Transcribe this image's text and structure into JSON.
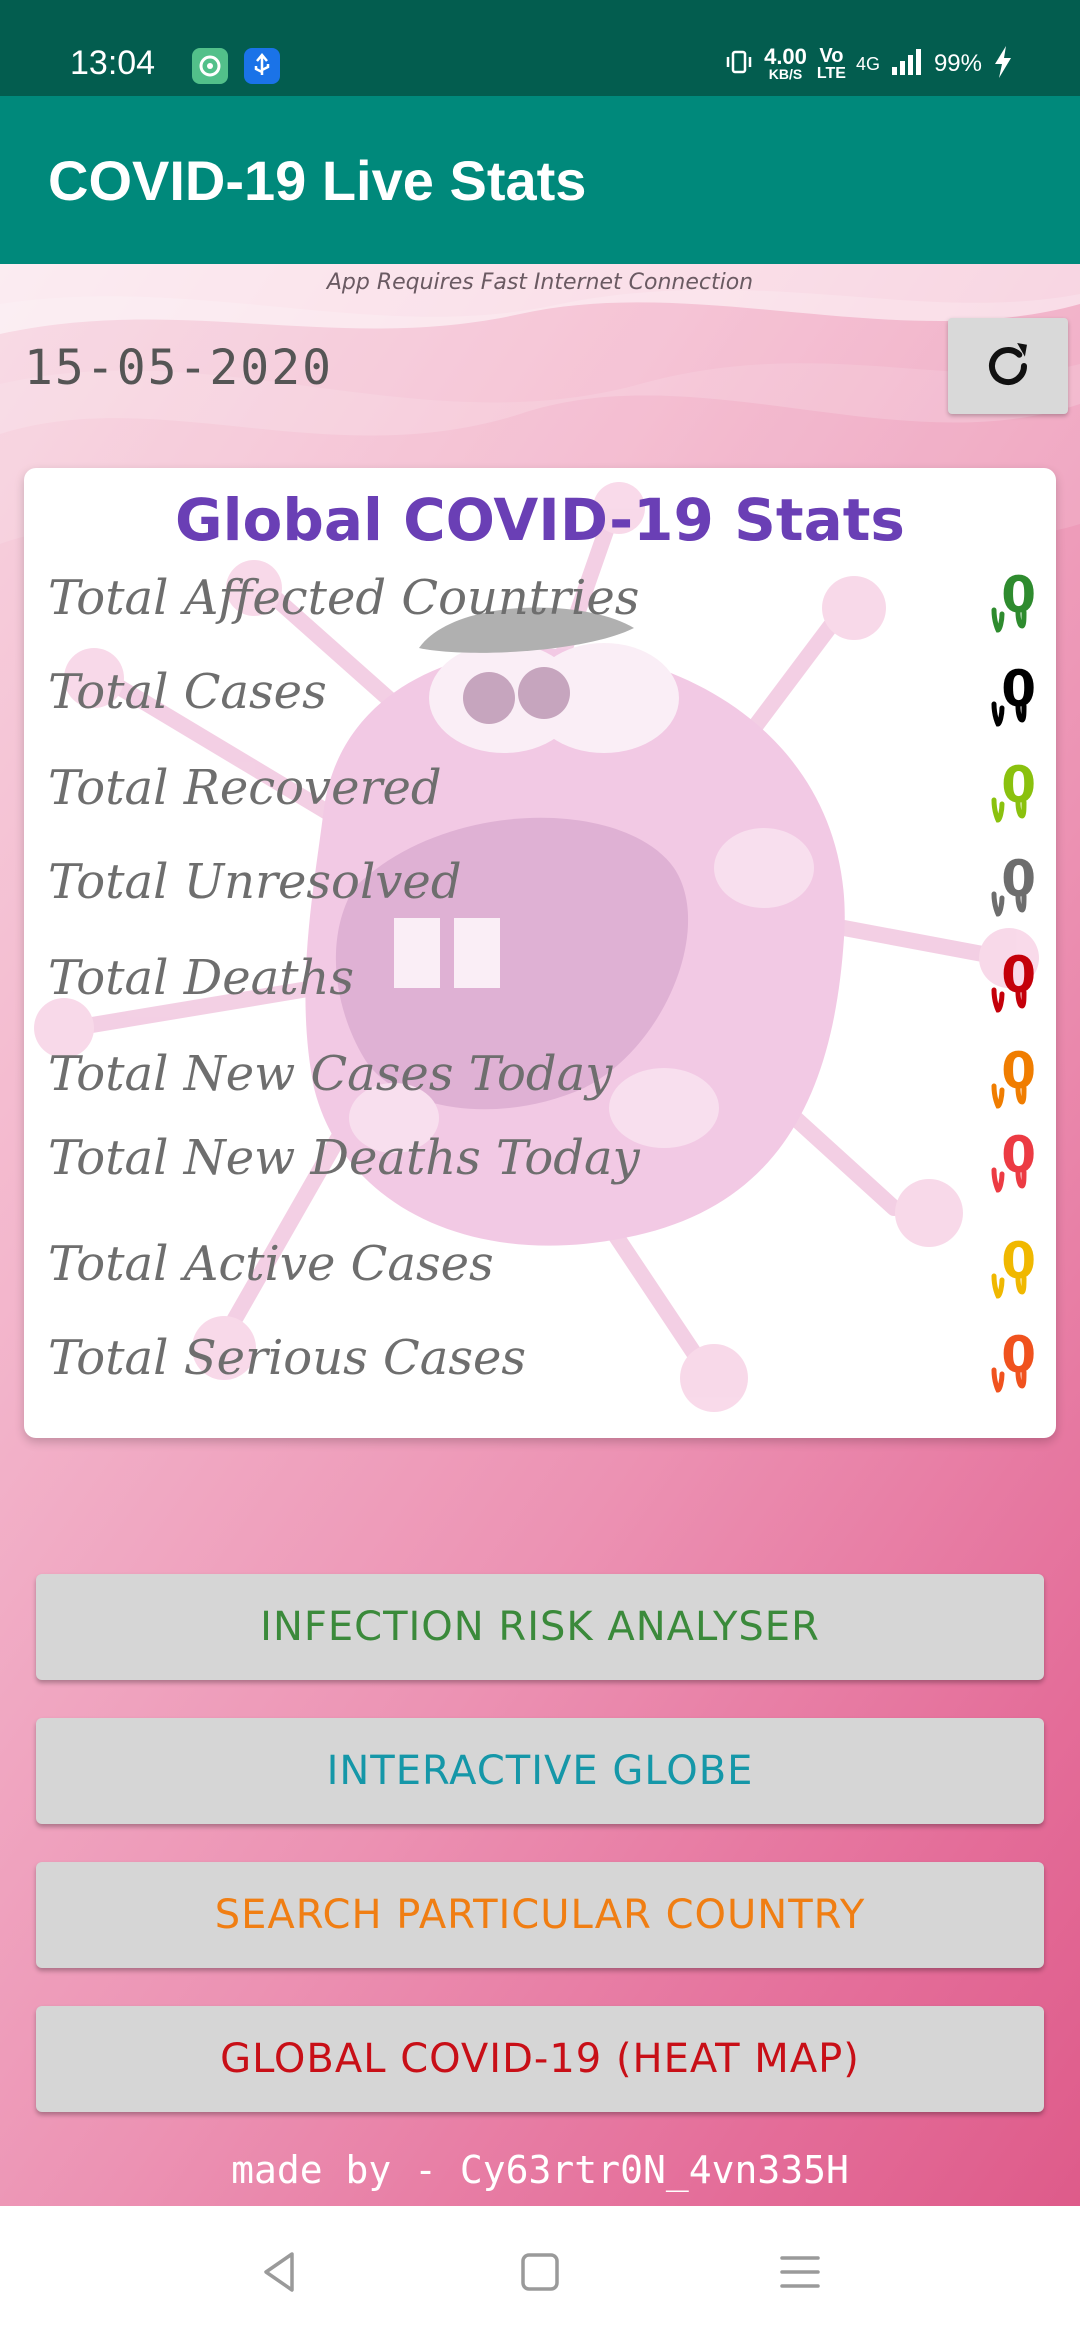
{
  "status_bar": {
    "time": "13:04",
    "speed_value": "4.00",
    "speed_unit": "KB/S",
    "volte_top": "Vo",
    "volte_bottom": "LTE",
    "network": "4G",
    "battery": "99%"
  },
  "app_bar": {
    "title": "COVID-19 Live Stats"
  },
  "header": {
    "hint": "App Requires Fast Internet Connection",
    "date": "15-05-2020"
  },
  "stats": {
    "title": "Global COVID-19 Stats",
    "rows": [
      {
        "label": "Total Affected Countries",
        "value": "0",
        "color": "#2e8b2e"
      },
      {
        "label": "Total Cases",
        "value": "0",
        "color": "#000000"
      },
      {
        "label": "Total Recovered",
        "value": "0",
        "color": "#8ac10e"
      },
      {
        "label": "Total Unresolved",
        "value": "0",
        "color": "#6d6d6d"
      },
      {
        "label": "Total Deaths",
        "value": "0",
        "color": "#c4000a"
      },
      {
        "label": "Total New Cases Today",
        "value": "0",
        "color": "#f07d00"
      },
      {
        "label": "Total New Deaths Today",
        "value": "0",
        "color": "#ec3b43"
      },
      {
        "label": "Total Active Cases",
        "value": "0",
        "color": "#f0b800"
      },
      {
        "label": "Total Serious Cases",
        "value": "0",
        "color": "#f0521e"
      }
    ]
  },
  "buttons": {
    "risk": {
      "label": "INFECTION RISK ANALYSER",
      "color": "#3b8a3b"
    },
    "globe": {
      "label": "INTERACTIVE GLOBE",
      "color": "#1597a8"
    },
    "search": {
      "label": "SEARCH PARTICULAR COUNTRY",
      "color": "#f07e13"
    },
    "heatmap": {
      "label": "GLOBAL COVID-19 (HEAT MAP)",
      "color": "#c80f17"
    }
  },
  "footer": {
    "credit": "made by - Cy63rtr0N_4vn335H"
  }
}
